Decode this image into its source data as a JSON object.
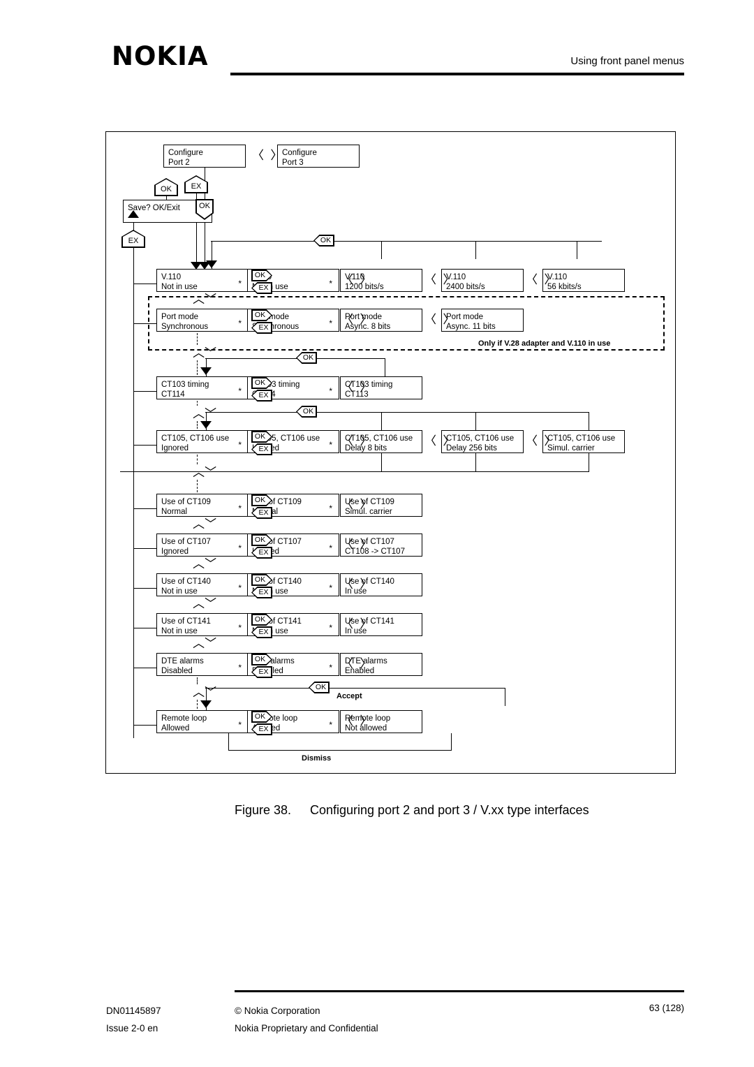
{
  "header": {
    "logo": "NOKIA",
    "title": "Using front panel menus"
  },
  "caption": {
    "number": "Figure 38.",
    "text": "Configuring port 2 and port 3 / V.xx type interfaces"
  },
  "footer": {
    "doc_number": "DN01145897",
    "issue": "Issue 2-0 en",
    "copyright": "© Nokia Corporation",
    "confidential": "Nokia Proprietary and Confidential",
    "page": "63 (128)"
  },
  "keys": {
    "ok": "OK",
    "ex": "EX",
    "lr": "〈〉",
    "star": "*"
  },
  "diagram": {
    "top": {
      "configure_port2": {
        "l1": "Configure",
        "l2": "Port 2"
      },
      "configure_port3": {
        "l1": "Configure",
        "l2": "Port 3"
      },
      "save_prompt": "Save? OK/Exit"
    },
    "notes": {
      "v28": "Only if V.28 adapter and V.110 in use",
      "accept": "Accept",
      "dismiss": "Dismiss"
    },
    "rows": [
      {
        "id": "v110",
        "title": "V.110",
        "boxes": [
          {
            "l1": "V.110",
            "l2": "Not in use",
            "star": true
          },
          {
            "l1": "V.110",
            "l2": "Not in use",
            "star": true
          },
          {
            "l1": "V.110",
            "l2": "1200 bits/s",
            "star": false
          },
          {
            "l1": "V.110",
            "l2": "2400 bits/s",
            "star": false
          },
          {
            "l1": "V.110",
            "l2": "56 kbits/s",
            "star": false
          }
        ]
      },
      {
        "id": "port-mode",
        "title": "Port mode",
        "boxes": [
          {
            "l1": "Port mode",
            "l2": "Synchronous",
            "star": true
          },
          {
            "l1": "Port mode",
            "l2": "Synchronous",
            "star": true
          },
          {
            "l1": "Port mode",
            "l2": "Async. 8 bits",
            "star": false
          },
          {
            "l1": "Port mode",
            "l2": "Async. 11 bits",
            "star": false
          }
        ]
      },
      {
        "id": "ct103-timing",
        "title": "CT103 timing",
        "boxes": [
          {
            "l1": "CT103 timing",
            "l2": "CT114",
            "star": true
          },
          {
            "l1": "CT103 timing",
            "l2": "CT114",
            "star": true
          },
          {
            "l1": "CT103 timing",
            "l2": "CT113",
            "star": false
          }
        ]
      },
      {
        "id": "ct105-ct106",
        "title": "CT105, CT106 use",
        "boxes": [
          {
            "l1": "CT105, CT106 use",
            "l2": "Ignored",
            "star": true
          },
          {
            "l1": "CT105, CT106 use",
            "l2": "Ignored",
            "star": true
          },
          {
            "l1": "CT105, CT106 use",
            "l2": "Delay 8 bits",
            "star": false
          },
          {
            "l1": "CT105, CT106 use",
            "l2": "Delay 256 bits",
            "star": false
          },
          {
            "l1": "CT105, CT106 use",
            "l2": "Simul. carrier",
            "star": false
          }
        ]
      },
      {
        "id": "ct109",
        "title": "Use of CT109",
        "boxes": [
          {
            "l1": "Use of CT109",
            "l2": "Normal",
            "star": true
          },
          {
            "l1": "Use of CT109",
            "l2": "Normal",
            "star": true
          },
          {
            "l1": "Use of CT109",
            "l2": "Simul. carrier",
            "star": false
          }
        ]
      },
      {
        "id": "ct107",
        "title": "Use of CT107",
        "boxes": [
          {
            "l1": "Use of CT107",
            "l2": "Ignored",
            "star": true
          },
          {
            "l1": "Use of CT107",
            "l2": "Ignored",
            "star": true
          },
          {
            "l1": "Use of CT107",
            "l2": "CT108 -> CT107",
            "star": false
          }
        ]
      },
      {
        "id": "ct140",
        "title": "Use of CT140",
        "boxes": [
          {
            "l1": "Use of CT140",
            "l2": "Not in use",
            "star": true
          },
          {
            "l1": "Use of CT140",
            "l2": "Not in use",
            "star": true
          },
          {
            "l1": "Use of CT140",
            "l2": "In use",
            "star": false
          }
        ]
      },
      {
        "id": "ct141",
        "title": "Use of CT141",
        "boxes": [
          {
            "l1": "Use of CT141",
            "l2": "Not in use",
            "star": true
          },
          {
            "l1": "Use of CT141",
            "l2": "Not in use",
            "star": true
          },
          {
            "l1": "Use of CT141",
            "l2": "In use",
            "star": false
          }
        ]
      },
      {
        "id": "dte-alarms",
        "title": "DTE alarms",
        "boxes": [
          {
            "l1": "DTE alarms",
            "l2": "Disabled",
            "star": true
          },
          {
            "l1": "DTE alarms",
            "l2": "Disabled",
            "star": true
          },
          {
            "l1": "DTE alarms",
            "l2": "Enabled",
            "star": false
          }
        ]
      },
      {
        "id": "remote-loop",
        "title": "Remote loop",
        "boxes": [
          {
            "l1": "Remote loop",
            "l2": "Allowed",
            "star": true
          },
          {
            "l1": "Remote loop",
            "l2": "Allowed",
            "star": true
          },
          {
            "l1": "Remote loop",
            "l2": "Not allowed",
            "star": false
          }
        ]
      }
    ]
  }
}
